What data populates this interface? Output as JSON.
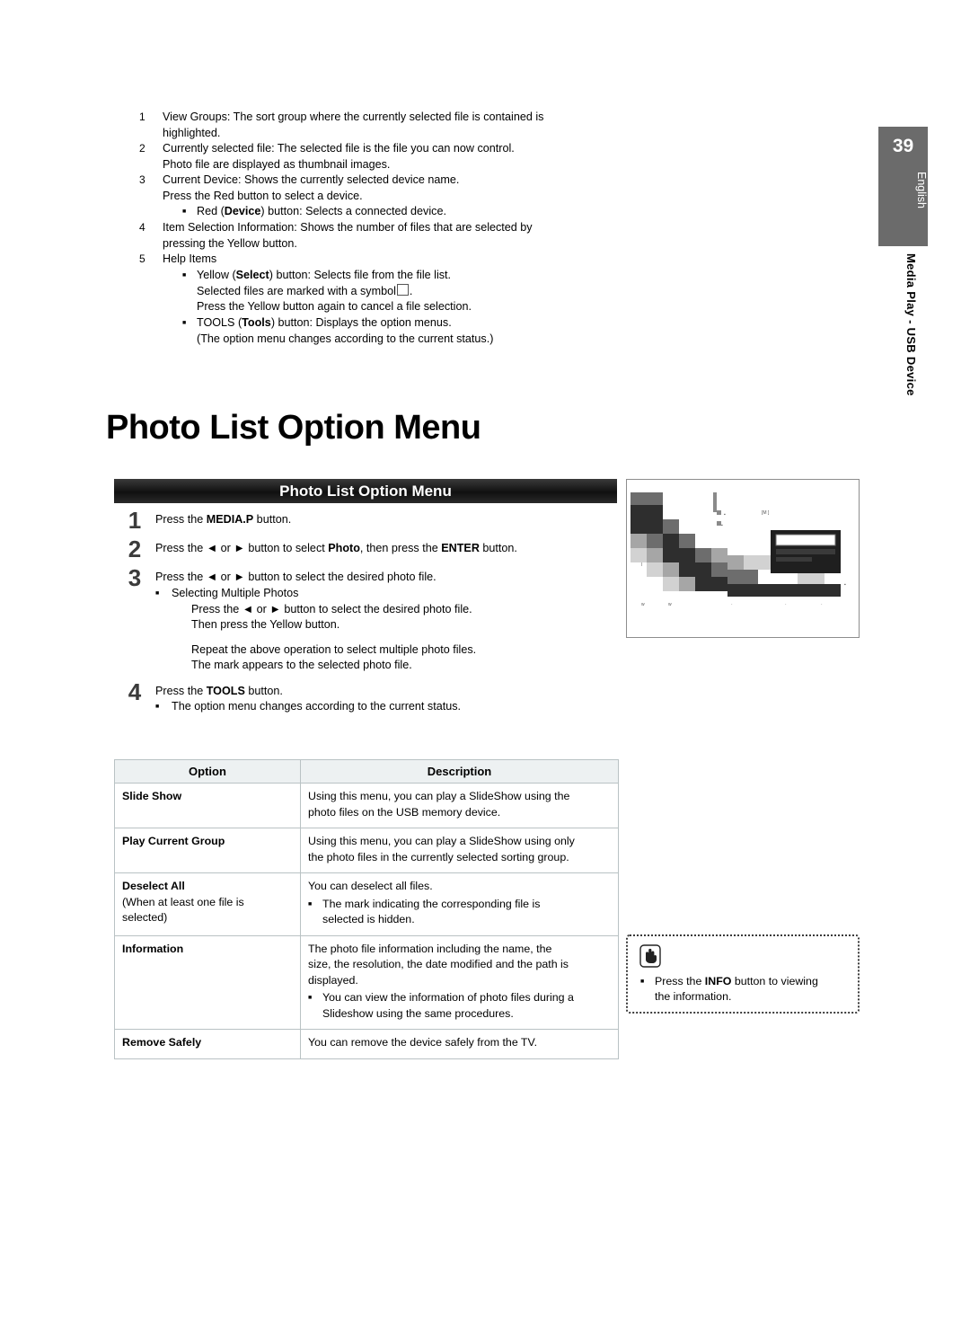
{
  "page": {
    "number": "39",
    "language": "English",
    "side_label": "Media Play - USB Device"
  },
  "top_list": [
    {
      "num": "1",
      "lines": [
        "View Groups: The sort group where the currently selected file is contained is",
        "highlighted."
      ],
      "bullets": []
    },
    {
      "num": "2",
      "lines": [
        "Currently selected file: The selected file is the file you can now control.",
        "Photo file are displayed as thumbnail images."
      ],
      "bullets": []
    },
    {
      "num": "3",
      "lines": [
        "Current Device: Shows the currently selected device name.",
        "Press the Red button to select a device."
      ],
      "bullets": [
        {
          "pre": "Red (",
          "bold": "Device",
          "post": ") button: Selects a connected device."
        }
      ]
    },
    {
      "num": "4",
      "lines": [
        "Item Selection Information: Shows the number of files that are selected by",
        "pressing the Yellow button."
      ],
      "bullets": []
    },
    {
      "num": "5",
      "lines": [
        "Help Items"
      ],
      "bullets": [
        {
          "pre": "Yellow (",
          "bold": "Select",
          "post": ") button: Selects file from the file list."
        },
        {
          "pre": "TOOLS (",
          "bold": "Tools",
          "post": ") button: Displays the option menus."
        }
      ]
    }
  ],
  "top_list_extra": {
    "select_sub1": "Selected files are marked with a symbol",
    "select_sub1_end": ".",
    "select_sub2": "Press the Yellow button again to cancel a file selection.",
    "tools_sub1": "(The option menu changes according to the current status.)"
  },
  "main_title": "Photo List Option Menu",
  "title_bar": "Photo List Option Menu",
  "steps": [
    {
      "num": "1",
      "text_pre": "Press the ",
      "text_bold": "MEDIA.P",
      "text_post": " button."
    },
    {
      "num": "2",
      "text_pre": "Press the ◄ or ► button to select ",
      "text_bold": "Photo",
      "text_mid": ", then press the ",
      "text_bold2": "ENTER",
      "text_post": "        button."
    },
    {
      "num": "3",
      "text": "Press the ◄ or ► button to select the desired photo file.",
      "bullet": "Selecting Multiple Photos",
      "sub_lines": [
        "Press the ◄ or ► button to select the desired photo file.",
        "Then press the Yellow button.",
        "Repeat the above operation to select multiple photo files.",
        "The mark       appears to the selected photo file."
      ]
    },
    {
      "num": "4",
      "text_pre": "Press the ",
      "text_bold": "TOOLS",
      "text_post": " button.",
      "bullet": "The option menu changes according to the current status."
    }
  ],
  "table": {
    "headers": [
      "Option",
      "Description"
    ],
    "rows": [
      {
        "option": "Slide Show",
        "option_sub": "",
        "desc": [
          "Using this menu, you can play a SlideShow using the",
          "photo files on the USB memory device."
        ],
        "bullets": []
      },
      {
        "option": "Play Current Group",
        "option_sub": "",
        "desc": [
          "Using this menu, you can play a SlideShow using only",
          "the photo files in the currently selected sorting group."
        ],
        "bullets": []
      },
      {
        "option": "Deselect All",
        "option_sub": "(When at least one file is\nselected)",
        "desc": [
          "You can deselect all files."
        ],
        "bullets": [
          "The        mark indicating the corresponding file is\nselected is hidden."
        ]
      },
      {
        "option": "Information",
        "option_sub": "",
        "desc": [
          "The photo file information including the name, the",
          "size, the resolution, the date modified and the path is",
          "displayed."
        ],
        "bullets": [
          "You can view the information of photo files during a\nSlideshow using the same procedures."
        ]
      },
      {
        "option": "Remove Safely",
        "option_sub": "",
        "desc": [
          "You can remove the device safely from the TV."
        ],
        "bullets": []
      }
    ]
  },
  "note": {
    "pre": "Press the ",
    "bold": "INFO",
    "post": " button to viewing",
    "line2": "the information."
  }
}
